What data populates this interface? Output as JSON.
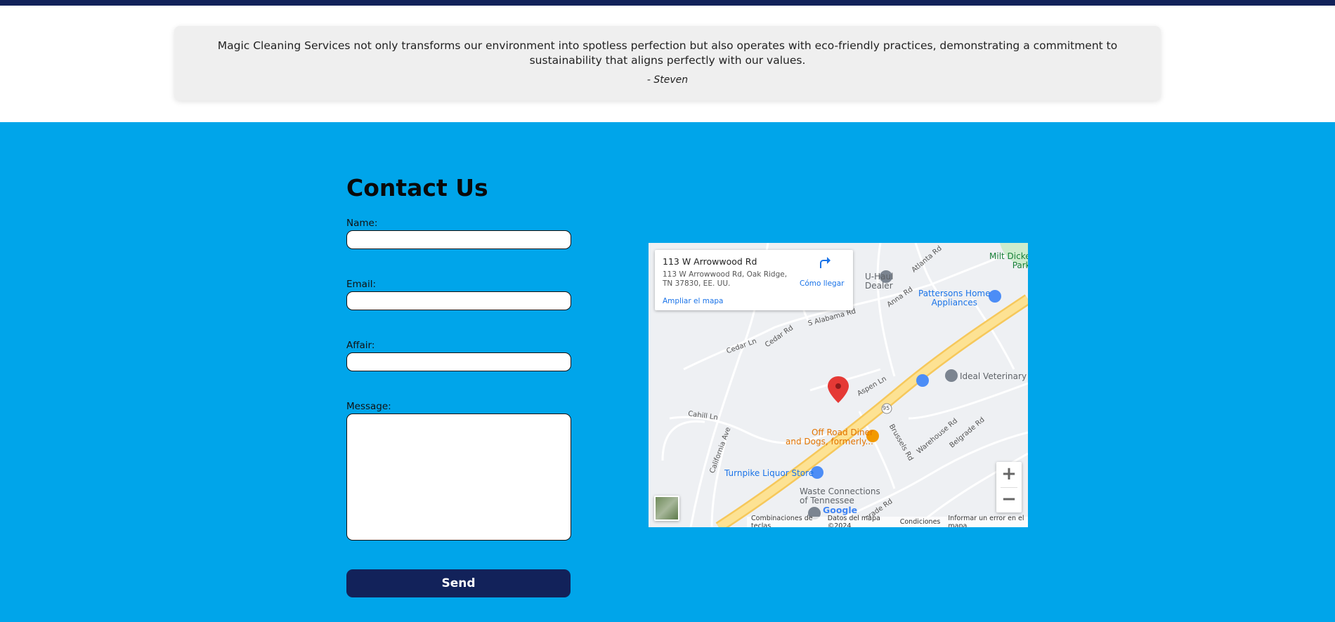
{
  "testimonial": {
    "quote": "Magic Cleaning Services not only transforms our environment into spotless perfection but also operates with eco-friendly practices, demonstrating a commitment to sustainability that aligns perfectly with our values.",
    "author": "- Steven"
  },
  "contact": {
    "title": "Contact Us",
    "name_label": "Name:",
    "email_label": "Email:",
    "affair_label": "Affair:",
    "message_label": "Message:",
    "send_label": "Send"
  },
  "map": {
    "place_title": "113 W Arrowwood Rd",
    "place_address": "113 W Arrowwood Rd, Oak Ridge, TN 37830, EE. UU.",
    "directions_label": "Cómo llegar",
    "enlarge_label": "Ampliar el mapa",
    "zoom_in": "+",
    "zoom_out": "−",
    "google": "Google",
    "attribution": {
      "shortcuts": "Combinaciones de teclas",
      "data": "Datos del mapa ©2024",
      "terms": "Condiciones",
      "report": "Informar un error en el mapa"
    },
    "poi": {
      "uhaul": "U-Haul\nDealer",
      "milt": "Milt Dicke\nPark",
      "pattersons": "Pattersons Home\nAppliances",
      "vet": "Ideal Veterinary H",
      "diner": "Off Road Diner\nand Dogs, formerly...",
      "liquor": "Turnpike Liquor Store",
      "waste": "Waste Connections\nof Tennessee"
    },
    "roads": {
      "atlanta": "Atlanta Rd",
      "anna": "Anna Rd",
      "alabama": "S Alabama Rd",
      "cedar_ln": "Cedar Ln",
      "cedar_rd": "Cedar Rd",
      "aspen": "Aspen Ln",
      "cahill": "Cahill Ln",
      "california": "California Ave",
      "brussels": "Brussels Rd",
      "warehouse": "Warehouse Rd",
      "belgrade": "Belgrade Rd",
      "belgrade2": "grade Rd",
      "hwy": "95"
    }
  }
}
